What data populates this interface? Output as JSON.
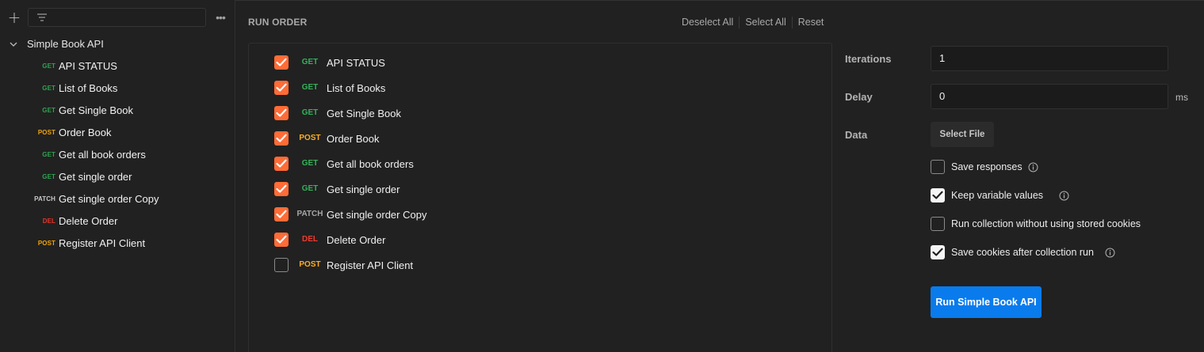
{
  "sidebar": {
    "collection_name": "Simple Book API",
    "items": [
      {
        "method": "GET",
        "label": "API STATUS"
      },
      {
        "method": "GET",
        "label": "List of Books"
      },
      {
        "method": "GET",
        "label": "Get Single Book"
      },
      {
        "method": "POST",
        "label": "Order Book"
      },
      {
        "method": "GET",
        "label": "Get all book orders"
      },
      {
        "method": "GET",
        "label": "Get single order"
      },
      {
        "method": "PATCH",
        "label": "Get single order Copy"
      },
      {
        "method": "DEL",
        "label": "Delete Order"
      },
      {
        "method": "POST",
        "label": "Register API Client"
      }
    ]
  },
  "run_order": {
    "title": "RUN ORDER",
    "deselect_all": "Deselect All",
    "select_all": "Select All",
    "reset": "Reset",
    "rows": [
      {
        "method": "GET",
        "label": "API STATUS",
        "checked": true
      },
      {
        "method": "GET",
        "label": "List of Books",
        "checked": true
      },
      {
        "method": "GET",
        "label": "Get Single Book",
        "checked": true
      },
      {
        "method": "POST",
        "label": "Order Book",
        "checked": true
      },
      {
        "method": "GET",
        "label": "Get all book orders",
        "checked": true
      },
      {
        "method": "GET",
        "label": "Get single order",
        "checked": true
      },
      {
        "method": "PATCH",
        "label": "Get single order Copy",
        "checked": true
      },
      {
        "method": "DEL",
        "label": "Delete Order",
        "checked": true
      },
      {
        "method": "POST",
        "label": "Register API Client",
        "checked": false
      }
    ]
  },
  "settings": {
    "iterations_label": "Iterations",
    "iterations_value": "1",
    "delay_label": "Delay",
    "delay_value": "0",
    "delay_unit": "ms",
    "data_label": "Data",
    "select_file": "Select File",
    "options": [
      {
        "label": "Save responses",
        "checked": false,
        "info": true
      },
      {
        "label": "Keep variable values",
        "checked": true,
        "info": true
      },
      {
        "label": "Run collection without using stored cookies",
        "checked": false,
        "info": false
      },
      {
        "label": "Save cookies after collection run",
        "checked": true,
        "info": true
      }
    ],
    "run_button": "Run Simple Book API"
  },
  "colors": {
    "accent_orange": "#ff6c37",
    "run_blue": "#097bed",
    "get": "#2ea44f",
    "post": "#f0a30a",
    "del": "#e5352b"
  }
}
